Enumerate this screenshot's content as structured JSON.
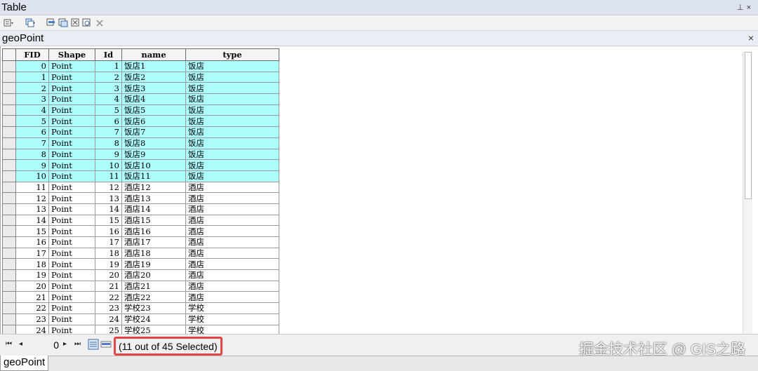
{
  "window": {
    "title": "Table"
  },
  "tab": {
    "name": "geoPoint",
    "close": "×"
  },
  "table": {
    "columns": [
      "FID",
      "Shape",
      "Id",
      "name",
      "type"
    ],
    "rows": [
      {
        "fid": "0",
        "shape": "Point",
        "id": "1",
        "name": "饭店1",
        "type": "饭店",
        "selected": true
      },
      {
        "fid": "1",
        "shape": "Point",
        "id": "2",
        "name": "饭店2",
        "type": "饭店",
        "selected": true
      },
      {
        "fid": "2",
        "shape": "Point",
        "id": "3",
        "name": "饭店3",
        "type": "饭店",
        "selected": true
      },
      {
        "fid": "3",
        "shape": "Point",
        "id": "4",
        "name": "饭店4",
        "type": "饭店",
        "selected": true
      },
      {
        "fid": "4",
        "shape": "Point",
        "id": "5",
        "name": "饭店5",
        "type": "饭店",
        "selected": true
      },
      {
        "fid": "5",
        "shape": "Point",
        "id": "6",
        "name": "饭店6",
        "type": "饭店",
        "selected": true
      },
      {
        "fid": "6",
        "shape": "Point",
        "id": "7",
        "name": "饭店7",
        "type": "饭店",
        "selected": true
      },
      {
        "fid": "7",
        "shape": "Point",
        "id": "8",
        "name": "饭店8",
        "type": "饭店",
        "selected": true
      },
      {
        "fid": "8",
        "shape": "Point",
        "id": "9",
        "name": "饭店9",
        "type": "饭店",
        "selected": true
      },
      {
        "fid": "9",
        "shape": "Point",
        "id": "10",
        "name": "饭店10",
        "type": "饭店",
        "selected": true
      },
      {
        "fid": "10",
        "shape": "Point",
        "id": "11",
        "name": "饭店11",
        "type": "饭店",
        "selected": true
      },
      {
        "fid": "11",
        "shape": "Point",
        "id": "12",
        "name": "酒店12",
        "type": "酒店",
        "selected": false
      },
      {
        "fid": "12",
        "shape": "Point",
        "id": "13",
        "name": "酒店13",
        "type": "酒店",
        "selected": false
      },
      {
        "fid": "13",
        "shape": "Point",
        "id": "14",
        "name": "酒店14",
        "type": "酒店",
        "selected": false
      },
      {
        "fid": "14",
        "shape": "Point",
        "id": "15",
        "name": "酒店15",
        "type": "酒店",
        "selected": false
      },
      {
        "fid": "15",
        "shape": "Point",
        "id": "16",
        "name": "酒店16",
        "type": "酒店",
        "selected": false
      },
      {
        "fid": "16",
        "shape": "Point",
        "id": "17",
        "name": "酒店17",
        "type": "酒店",
        "selected": false
      },
      {
        "fid": "17",
        "shape": "Point",
        "id": "18",
        "name": "酒店18",
        "type": "酒店",
        "selected": false
      },
      {
        "fid": "18",
        "shape": "Point",
        "id": "19",
        "name": "酒店19",
        "type": "酒店",
        "selected": false
      },
      {
        "fid": "19",
        "shape": "Point",
        "id": "20",
        "name": "酒店20",
        "type": "酒店",
        "selected": false
      },
      {
        "fid": "20",
        "shape": "Point",
        "id": "21",
        "name": "酒店21",
        "type": "酒店",
        "selected": false
      },
      {
        "fid": "21",
        "shape": "Point",
        "id": "22",
        "name": "酒店22",
        "type": "酒店",
        "selected": false
      },
      {
        "fid": "22",
        "shape": "Point",
        "id": "23",
        "name": "学校23",
        "type": "学校",
        "selected": false
      },
      {
        "fid": "23",
        "shape": "Point",
        "id": "24",
        "name": "学校24",
        "type": "学校",
        "selected": false
      },
      {
        "fid": "24",
        "shape": "Point",
        "id": "25",
        "name": "学校25",
        "type": "学校",
        "selected": false
      }
    ]
  },
  "status": {
    "page": "0",
    "selection": "(11 out of 45 Selected)"
  },
  "watermark": "掘金技术社区 @ GIS之路",
  "bottom_tab": "geoPoint",
  "colors": {
    "selected_row": "#aefefd",
    "highlight_border": "#e04848"
  }
}
